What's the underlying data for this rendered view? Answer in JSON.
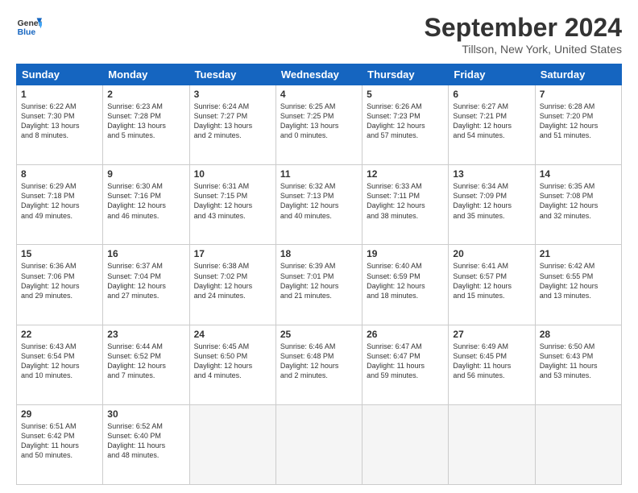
{
  "header": {
    "logo_general": "General",
    "logo_blue": "Blue",
    "month_title": "September 2024",
    "location": "Tillson, New York, United States"
  },
  "days_of_week": [
    "Sunday",
    "Monday",
    "Tuesday",
    "Wednesday",
    "Thursday",
    "Friday",
    "Saturday"
  ],
  "weeks": [
    [
      {
        "day": "1",
        "lines": [
          "Sunrise: 6:22 AM",
          "Sunset: 7:30 PM",
          "Daylight: 13 hours",
          "and 8 minutes."
        ]
      },
      {
        "day": "2",
        "lines": [
          "Sunrise: 6:23 AM",
          "Sunset: 7:28 PM",
          "Daylight: 13 hours",
          "and 5 minutes."
        ]
      },
      {
        "day": "3",
        "lines": [
          "Sunrise: 6:24 AM",
          "Sunset: 7:27 PM",
          "Daylight: 13 hours",
          "and 2 minutes."
        ]
      },
      {
        "day": "4",
        "lines": [
          "Sunrise: 6:25 AM",
          "Sunset: 7:25 PM",
          "Daylight: 13 hours",
          "and 0 minutes."
        ]
      },
      {
        "day": "5",
        "lines": [
          "Sunrise: 6:26 AM",
          "Sunset: 7:23 PM",
          "Daylight: 12 hours",
          "and 57 minutes."
        ]
      },
      {
        "day": "6",
        "lines": [
          "Sunrise: 6:27 AM",
          "Sunset: 7:21 PM",
          "Daylight: 12 hours",
          "and 54 minutes."
        ]
      },
      {
        "day": "7",
        "lines": [
          "Sunrise: 6:28 AM",
          "Sunset: 7:20 PM",
          "Daylight: 12 hours",
          "and 51 minutes."
        ]
      }
    ],
    [
      {
        "day": "8",
        "lines": [
          "Sunrise: 6:29 AM",
          "Sunset: 7:18 PM",
          "Daylight: 12 hours",
          "and 49 minutes."
        ]
      },
      {
        "day": "9",
        "lines": [
          "Sunrise: 6:30 AM",
          "Sunset: 7:16 PM",
          "Daylight: 12 hours",
          "and 46 minutes."
        ]
      },
      {
        "day": "10",
        "lines": [
          "Sunrise: 6:31 AM",
          "Sunset: 7:15 PM",
          "Daylight: 12 hours",
          "and 43 minutes."
        ]
      },
      {
        "day": "11",
        "lines": [
          "Sunrise: 6:32 AM",
          "Sunset: 7:13 PM",
          "Daylight: 12 hours",
          "and 40 minutes."
        ]
      },
      {
        "day": "12",
        "lines": [
          "Sunrise: 6:33 AM",
          "Sunset: 7:11 PM",
          "Daylight: 12 hours",
          "and 38 minutes."
        ]
      },
      {
        "day": "13",
        "lines": [
          "Sunrise: 6:34 AM",
          "Sunset: 7:09 PM",
          "Daylight: 12 hours",
          "and 35 minutes."
        ]
      },
      {
        "day": "14",
        "lines": [
          "Sunrise: 6:35 AM",
          "Sunset: 7:08 PM",
          "Daylight: 12 hours",
          "and 32 minutes."
        ]
      }
    ],
    [
      {
        "day": "15",
        "lines": [
          "Sunrise: 6:36 AM",
          "Sunset: 7:06 PM",
          "Daylight: 12 hours",
          "and 29 minutes."
        ]
      },
      {
        "day": "16",
        "lines": [
          "Sunrise: 6:37 AM",
          "Sunset: 7:04 PM",
          "Daylight: 12 hours",
          "and 27 minutes."
        ]
      },
      {
        "day": "17",
        "lines": [
          "Sunrise: 6:38 AM",
          "Sunset: 7:02 PM",
          "Daylight: 12 hours",
          "and 24 minutes."
        ]
      },
      {
        "day": "18",
        "lines": [
          "Sunrise: 6:39 AM",
          "Sunset: 7:01 PM",
          "Daylight: 12 hours",
          "and 21 minutes."
        ]
      },
      {
        "day": "19",
        "lines": [
          "Sunrise: 6:40 AM",
          "Sunset: 6:59 PM",
          "Daylight: 12 hours",
          "and 18 minutes."
        ]
      },
      {
        "day": "20",
        "lines": [
          "Sunrise: 6:41 AM",
          "Sunset: 6:57 PM",
          "Daylight: 12 hours",
          "and 15 minutes."
        ]
      },
      {
        "day": "21",
        "lines": [
          "Sunrise: 6:42 AM",
          "Sunset: 6:55 PM",
          "Daylight: 12 hours",
          "and 13 minutes."
        ]
      }
    ],
    [
      {
        "day": "22",
        "lines": [
          "Sunrise: 6:43 AM",
          "Sunset: 6:54 PM",
          "Daylight: 12 hours",
          "and 10 minutes."
        ]
      },
      {
        "day": "23",
        "lines": [
          "Sunrise: 6:44 AM",
          "Sunset: 6:52 PM",
          "Daylight: 12 hours",
          "and 7 minutes."
        ]
      },
      {
        "day": "24",
        "lines": [
          "Sunrise: 6:45 AM",
          "Sunset: 6:50 PM",
          "Daylight: 12 hours",
          "and 4 minutes."
        ]
      },
      {
        "day": "25",
        "lines": [
          "Sunrise: 6:46 AM",
          "Sunset: 6:48 PM",
          "Daylight: 12 hours",
          "and 2 minutes."
        ]
      },
      {
        "day": "26",
        "lines": [
          "Sunrise: 6:47 AM",
          "Sunset: 6:47 PM",
          "Daylight: 11 hours",
          "and 59 minutes."
        ]
      },
      {
        "day": "27",
        "lines": [
          "Sunrise: 6:49 AM",
          "Sunset: 6:45 PM",
          "Daylight: 11 hours",
          "and 56 minutes."
        ]
      },
      {
        "day": "28",
        "lines": [
          "Sunrise: 6:50 AM",
          "Sunset: 6:43 PM",
          "Daylight: 11 hours",
          "and 53 minutes."
        ]
      }
    ],
    [
      {
        "day": "29",
        "lines": [
          "Sunrise: 6:51 AM",
          "Sunset: 6:42 PM",
          "Daylight: 11 hours",
          "and 50 minutes."
        ]
      },
      {
        "day": "30",
        "lines": [
          "Sunrise: 6:52 AM",
          "Sunset: 6:40 PM",
          "Daylight: 11 hours",
          "and 48 minutes."
        ]
      },
      null,
      null,
      null,
      null,
      null
    ]
  ]
}
